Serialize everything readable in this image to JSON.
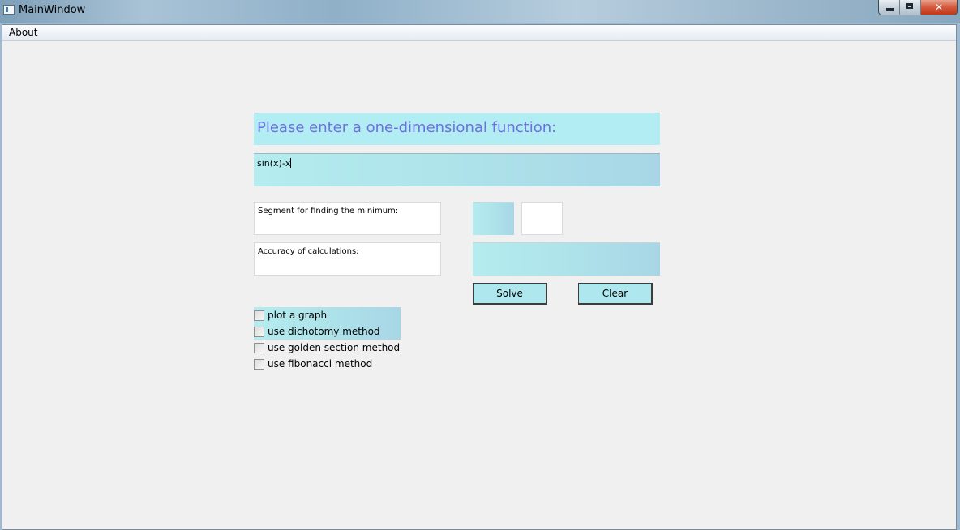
{
  "window": {
    "title": "MainWindow"
  },
  "menubar": {
    "items": [
      {
        "label": "About"
      }
    ]
  },
  "form": {
    "prompt": "Please enter a one-dimensional function:",
    "function_value": "sin(x)-x",
    "segment_label": "Segment for finding the minimum:",
    "segment_start_value": "",
    "segment_end_value": "",
    "accuracy_label": "Accuracy of calculations:",
    "accuracy_value": ""
  },
  "buttons": {
    "solve": "Solve",
    "clear": "Clear"
  },
  "options": [
    {
      "label": "plot a graph",
      "checked": false
    },
    {
      "label": "use dichotomy method",
      "checked": false
    },
    {
      "label": "use golden section method",
      "checked": false
    },
    {
      "label": "use fibonacci method",
      "checked": false
    }
  ],
  "colors": {
    "accent_cyan": "#b1edf2",
    "prompt_text": "#6f6fe0",
    "client_background": "#f0f0f0"
  },
  "icons": {
    "app": "window-app-icon",
    "minimize": "minimize-icon",
    "maximize": "maximize-icon",
    "close": "close-icon"
  }
}
